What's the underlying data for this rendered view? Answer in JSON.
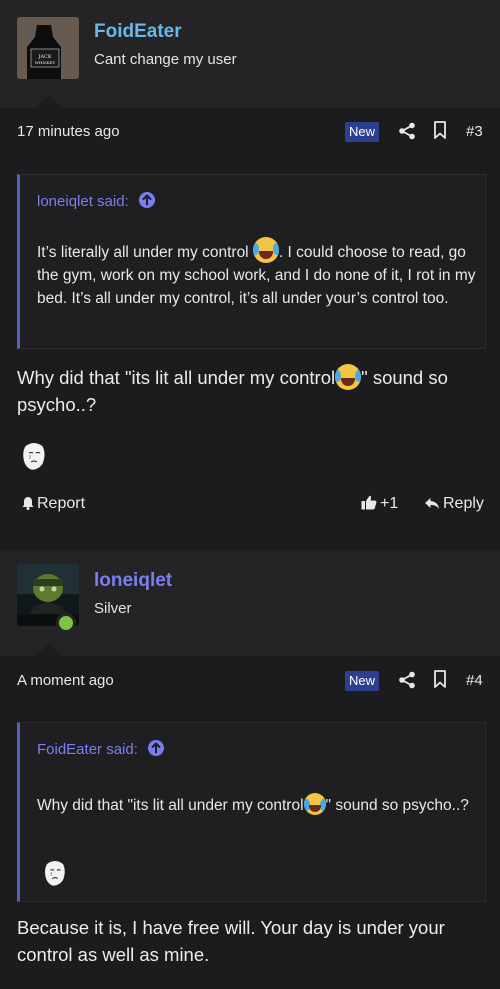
{
  "posts": [
    {
      "username": "FoidEater",
      "user_title": "Cant change my user",
      "time": "17 minutes ago",
      "badge": "New",
      "post_number": "#3",
      "quote": {
        "author_said": "loneiqlet said:",
        "text_1": "It’s literally all under my control ",
        "text_2": ". I could choose to read, go the gym, work on my school work, and I do none of it, I rot in my bed. It’s all under my control, it’s all under your’s control too."
      },
      "message_1": "Why did that \"its lit all under my control",
      "message_2": "\" sound so psycho..?",
      "report_label": "Report",
      "like_count": "+1",
      "reply_label": "Reply"
    },
    {
      "username": "loneiqlet",
      "user_title": "Silver",
      "time": "A moment ago",
      "badge": "New",
      "post_number": "#4",
      "quote": {
        "author_said": "FoidEater said:",
        "text_1": "Why did that \"its lit all under my control",
        "text_2": "\" sound so psycho..?"
      },
      "message": "Because it is, I have free will. Your day is under your control as well as mine."
    }
  ],
  "colors": {
    "background": "#1c1c1e",
    "header_background": "#242426",
    "username_blue": "#6ab8e8",
    "username_purple": "#7b7ef0",
    "badge_background": "#2d3f8f",
    "quote_border": "#5a5fc8",
    "online_status": "#7dc342"
  },
  "icons": [
    "share-icon",
    "bookmark-icon",
    "bell-icon",
    "thumbs-up-icon",
    "reply-arrow-icon",
    "up-arrow-icon",
    "joy-emoji",
    "wojak-sticker"
  ]
}
